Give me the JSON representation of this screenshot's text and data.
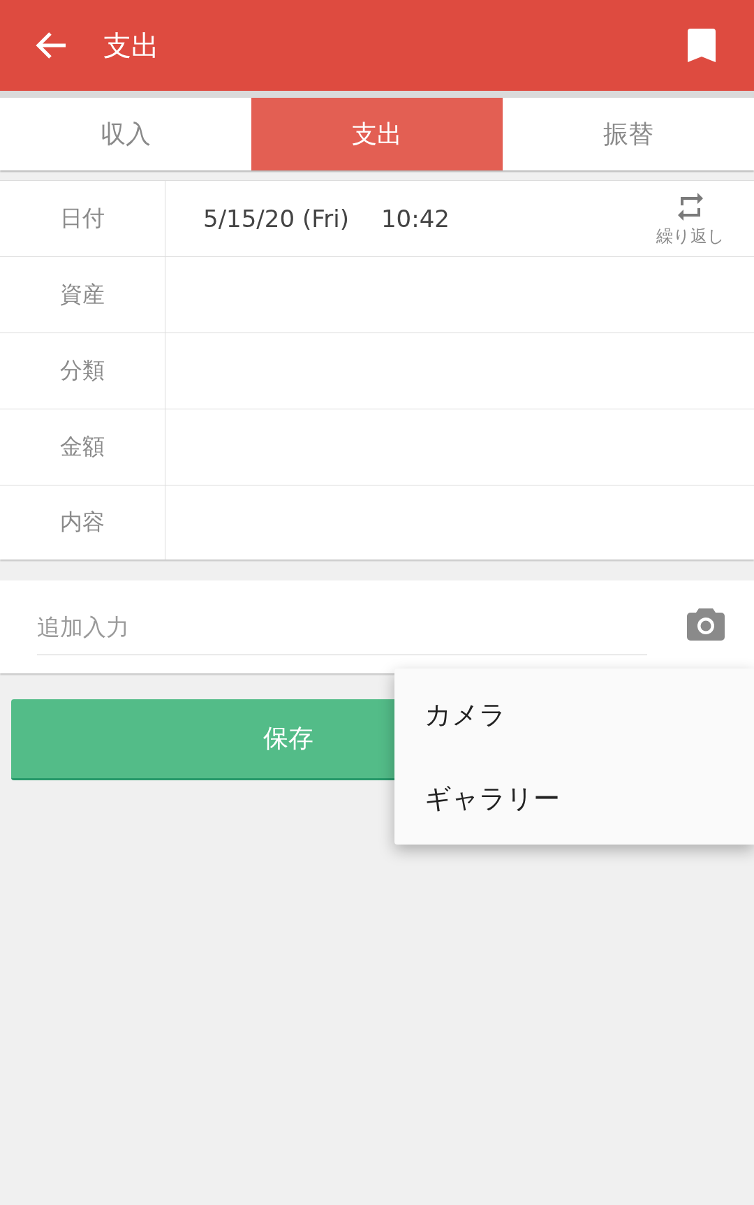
{
  "app_bar": {
    "title": "支出"
  },
  "tabs": [
    {
      "label": "収入",
      "selected": false
    },
    {
      "label": "支出",
      "selected": true
    },
    {
      "label": "振替",
      "selected": false
    }
  ],
  "form": {
    "rows": [
      {
        "kind": "datetime",
        "label": "日付",
        "date": "5/15/20 (Fri)",
        "time": "10:42",
        "repeat_label": "繰り返し"
      },
      {
        "kind": "field",
        "label": "資産"
      },
      {
        "kind": "field",
        "label": "分類"
      },
      {
        "kind": "field",
        "label": "金額"
      },
      {
        "kind": "field",
        "label": "内容"
      }
    ]
  },
  "extra_input": {
    "placeholder": "追加入力"
  },
  "save_button": {
    "label": "保存"
  },
  "popup_menu": {
    "items": [
      "カメラ",
      "ギャラリー"
    ]
  }
}
